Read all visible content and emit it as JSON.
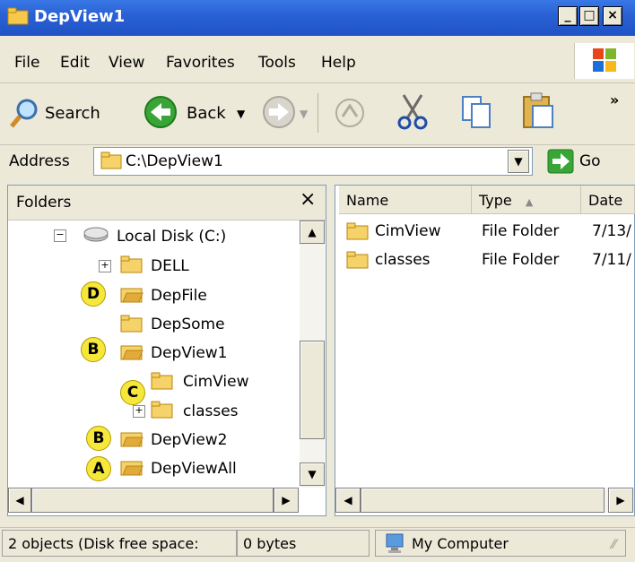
{
  "window": {
    "title": "DepView1"
  },
  "menu": [
    "File",
    "Edit",
    "View",
    "Favorites",
    "Tools",
    "Help"
  ],
  "toolbar": {
    "search": "Search",
    "back": "Back",
    "more": "»"
  },
  "address": {
    "label": "Address",
    "value": "C:\\DepView1",
    "go": "Go"
  },
  "folders": {
    "title": "Folders",
    "close": "×",
    "tree": [
      {
        "label": "Local Disk (C:)",
        "expander": "−",
        "badge": ""
      },
      {
        "label": "DELL",
        "expander": "+",
        "badge": ""
      },
      {
        "label": "DepFile",
        "expander": "",
        "badge": "D"
      },
      {
        "label": "DepSome",
        "expander": "",
        "badge": ""
      },
      {
        "label": "DepView1",
        "expander": "",
        "badge": "B"
      },
      {
        "label": "CimView",
        "expander": "",
        "badge": "C"
      },
      {
        "label": "classes",
        "expander": "+",
        "badge": ""
      },
      {
        "label": "DepView2",
        "expander": "",
        "badge": "B"
      },
      {
        "label": "DepViewAll",
        "expander": "",
        "badge": "A"
      }
    ]
  },
  "list": {
    "columns": [
      "Name",
      "Type",
      "Date"
    ],
    "rows": [
      {
        "name": "CimView",
        "type": "File Folder",
        "date": "7/13/"
      },
      {
        "name": "classes",
        "type": "File Folder",
        "date": "7/11/"
      }
    ]
  },
  "status": {
    "objects": "2 objects (Disk free space:",
    "size": "0 bytes",
    "zone": "My Computer"
  }
}
